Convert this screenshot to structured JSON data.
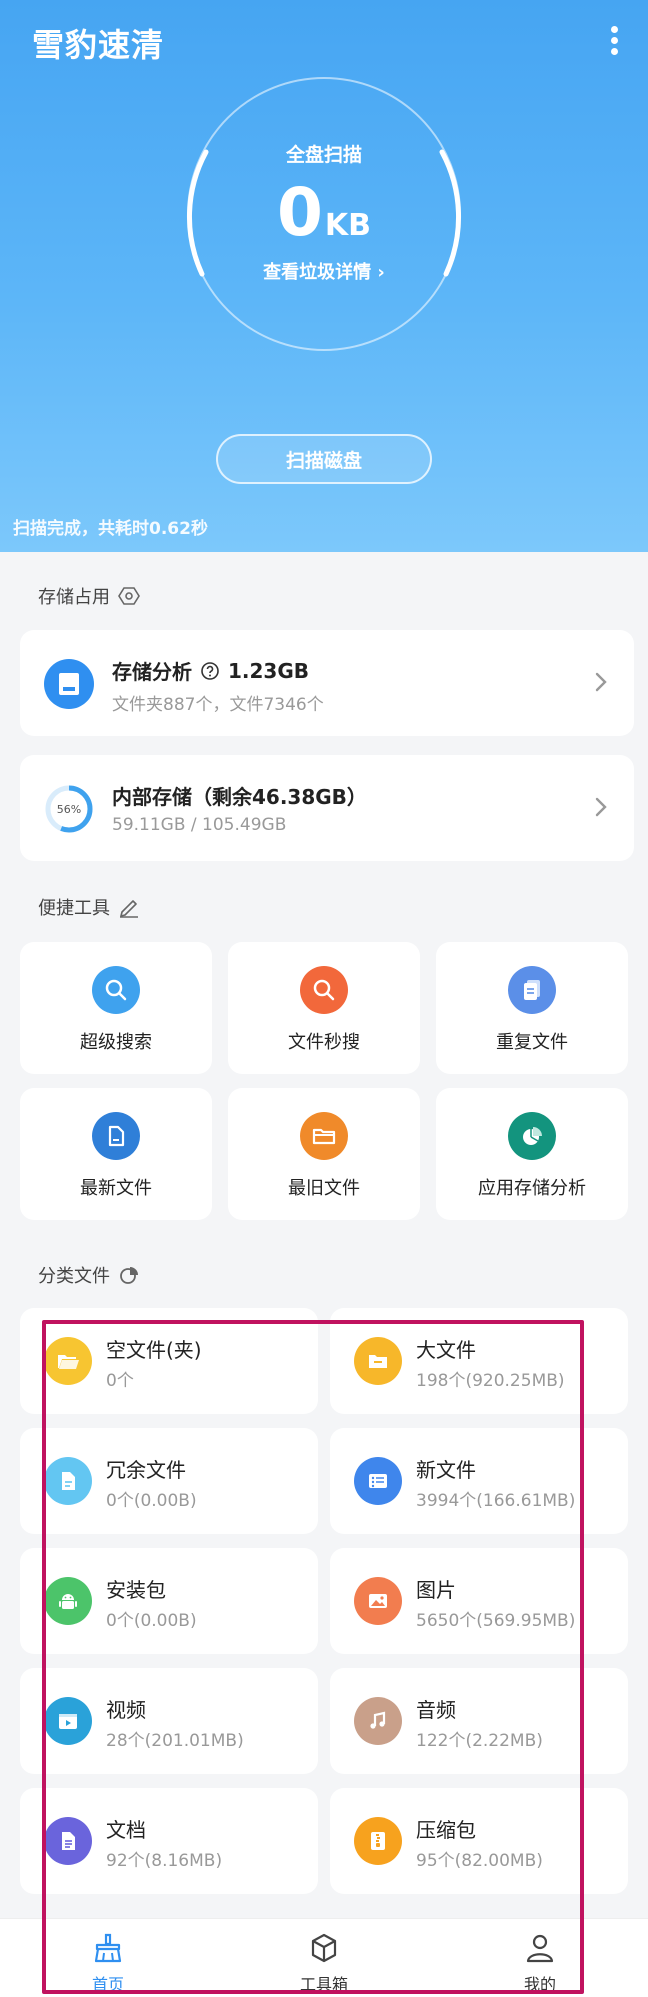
{
  "app": {
    "title": "雪豹速清"
  },
  "scan": {
    "title": "全盘扫描",
    "size_value": "0",
    "size_unit": "KB",
    "detail_link": "查看垃圾详情 ›",
    "button_label": "扫描磁盘",
    "status": "扫描完成，共耗时0.62秒"
  },
  "storage": {
    "section_title": "存储占用",
    "analysis": {
      "label": "存储分析",
      "value": "1.23GB",
      "sub": "文件夹887个，文件7346个"
    },
    "internal": {
      "label": "内部存储（剩余46.38GB）",
      "sub": "59.11GB / 105.49GB",
      "percent": "56%",
      "used_fraction": 0.56
    }
  },
  "tools": {
    "section_title": "便捷工具",
    "items": [
      {
        "label": "超级搜索",
        "icon": "magnifier-icon",
        "color": "#3fa2ee"
      },
      {
        "label": "文件秒搜",
        "icon": "magnifier-icon",
        "color": "#f2683b"
      },
      {
        "label": "重复文件",
        "icon": "duplicate-doc-icon",
        "color": "#5b8fe8"
      },
      {
        "label": "最新文件",
        "icon": "file-icon",
        "color": "#2f7fd8"
      },
      {
        "label": "最旧文件",
        "icon": "folder-icon",
        "color": "#f08a2a"
      },
      {
        "label": "应用存储分析",
        "icon": "pie-chart-icon",
        "color": "#13947e"
      }
    ]
  },
  "categories": {
    "section_title": "分类文件",
    "items": [
      {
        "name": "空文件(夹)",
        "sub": "0个",
        "icon": "folder-open-icon",
        "color": "#f7c531"
      },
      {
        "name": "大文件",
        "sub": "198个(920.25MB)",
        "icon": "folder-icon",
        "color": "#f7b72a"
      },
      {
        "name": "冗余文件",
        "sub": "0个(0.00B)",
        "icon": "doc-icon",
        "color": "#63c6f2"
      },
      {
        "name": "新文件",
        "sub": "3994个(166.61MB)",
        "icon": "list-icon",
        "color": "#3f86ec"
      },
      {
        "name": "安装包",
        "sub": "0个(0.00B)",
        "icon": "android-icon",
        "color": "#4cc46a"
      },
      {
        "name": "图片",
        "sub": "5650个(569.95MB)",
        "icon": "image-icon",
        "color": "#f27d4f"
      },
      {
        "name": "视频",
        "sub": "28个(201.01MB)",
        "icon": "video-icon",
        "color": "#2aa2d9"
      },
      {
        "name": "音频",
        "sub": "122个(2.22MB)",
        "icon": "music-icon",
        "color": "#c9a08a"
      },
      {
        "name": "文档",
        "sub": "92个(8.16MB)",
        "icon": "document-icon",
        "color": "#6a64dc"
      },
      {
        "name": "压缩包",
        "sub": "95个(82.00MB)",
        "icon": "zip-icon",
        "color": "#f7a21e"
      }
    ]
  },
  "nav": {
    "items": [
      {
        "label": "首页",
        "icon": "broom-icon",
        "active": true
      },
      {
        "label": "工具箱",
        "icon": "cube-icon",
        "active": false
      },
      {
        "label": "我的",
        "icon": "user-icon",
        "active": false
      }
    ]
  },
  "colors": {
    "accent": "#2f8ff0",
    "highlight_border": "#c0125f"
  }
}
